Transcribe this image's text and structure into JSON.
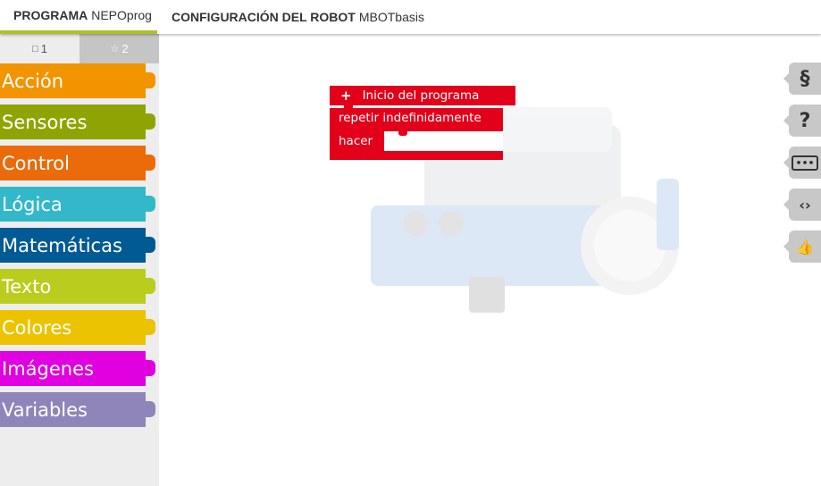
{
  "tabs": {
    "program": {
      "label": "PROGRAMA",
      "name": "NEPOprog"
    },
    "config": {
      "label": "CONFIGURACIÓN DEL ROBOT",
      "name": "MBOTbasis"
    }
  },
  "toolbox": {
    "levels": [
      {
        "label": "1",
        "icon": "square-outline-icon"
      },
      {
        "label": "2",
        "icon": "star-outline-icon"
      }
    ],
    "categories": [
      {
        "label": "Acción",
        "color": "#f29400"
      },
      {
        "label": "Sensores",
        "color": "#8fa402"
      },
      {
        "label": "Control",
        "color": "#eb6a0a"
      },
      {
        "label": "Lógica",
        "color": "#33b8ca"
      },
      {
        "label": "Matemáticas",
        "color": "#005a94"
      },
      {
        "label": "Texto",
        "color": "#bacc1e"
      },
      {
        "label": "Colores",
        "color": "#ebc300"
      },
      {
        "label": "Imágenes",
        "color": "#e0e000"
      },
      {
        "label": "Variables",
        "color": "#9085ba"
      }
    ]
  },
  "blocks": {
    "start": {
      "plus": "+",
      "label": "Inicio del programa",
      "color": "#e2001a"
    },
    "loop": {
      "label": "repetir indefinidamente",
      "do_label": "hacer"
    }
  },
  "side_buttons": [
    {
      "glyph": "§",
      "icon": "code-section-icon"
    },
    {
      "glyph": "?",
      "icon": "help-icon"
    },
    {
      "glyph": "•••",
      "icon": "comment-icon"
    },
    {
      "glyph": "‹›",
      "icon": "code-view-icon"
    },
    {
      "glyph": "👍",
      "icon": "feedback-icon"
    }
  ]
}
